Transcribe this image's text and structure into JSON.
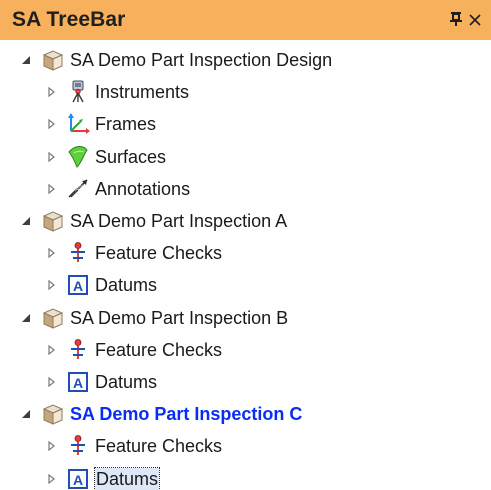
{
  "titlebar": {
    "title": "SA TreeBar",
    "pin_glyph": "▪",
    "close_glyph": "×"
  },
  "tree": {
    "nodes": [
      {
        "label": "SA Demo Part Inspection Design",
        "icon": "part-box-icon",
        "expanded": true,
        "children": [
          {
            "label": "Instruments",
            "icon": "instrument-icon"
          },
          {
            "label": "Frames",
            "icon": "frame-axes-icon"
          },
          {
            "label": "Surfaces",
            "icon": "surface-icon"
          },
          {
            "label": "Annotations",
            "icon": "annotation-icon"
          }
        ]
      },
      {
        "label": "SA Demo Part Inspection A",
        "icon": "part-box-icon",
        "expanded": true,
        "children": [
          {
            "label": "Feature Checks",
            "icon": "feature-check-icon"
          },
          {
            "label": "Datums",
            "icon": "datum-icon"
          }
        ]
      },
      {
        "label": "SA Demo Part Inspection B",
        "icon": "part-box-icon",
        "expanded": true,
        "children": [
          {
            "label": "Feature Checks",
            "icon": "feature-check-icon"
          },
          {
            "label": "Datums",
            "icon": "datum-icon"
          }
        ]
      },
      {
        "label": "SA Demo Part Inspection C",
        "icon": "part-box-icon",
        "expanded": true,
        "active": true,
        "children": [
          {
            "label": "Feature Checks",
            "icon": "feature-check-icon"
          },
          {
            "label": "Datums",
            "icon": "datum-icon",
            "selected": true
          }
        ]
      }
    ]
  },
  "colors": {
    "titlebar_bg": "#f7b15d",
    "active_label": "#0a2df4",
    "text": "#1a1a1a"
  }
}
